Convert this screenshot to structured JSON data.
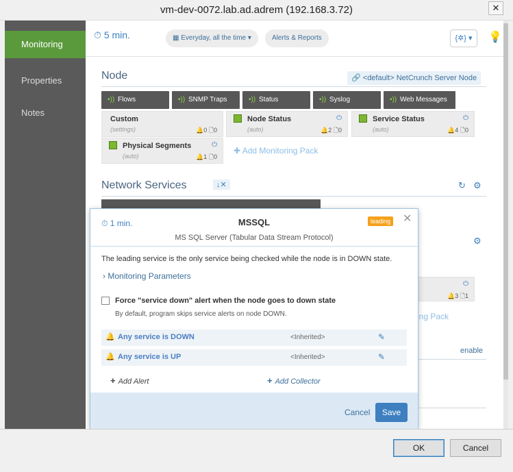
{
  "window": {
    "title": "vm-dev-0072.lab.ad.adrem (192.168.3.72)",
    "close": "✕"
  },
  "sidebar": {
    "items": [
      "Monitoring",
      "Properties",
      "Notes"
    ]
  },
  "toolbar": {
    "timer": "5 min.",
    "schedule": "Everyday, all the time",
    "alerts_reports": "Alerts & Reports",
    "settings": "{✲}"
  },
  "node": {
    "title": "Node",
    "default_tag": "<default> NetCrunch Server Node",
    "buttons": [
      "Flows",
      "SNMP Traps",
      "Status",
      "Syslog",
      "Web Messages"
    ],
    "cards": [
      {
        "name": "Custom",
        "sub": "(settings)",
        "counts": "🔔0 🗋0"
      },
      {
        "name": "Node Status",
        "sub": "(auto)",
        "counts": "🔔2 🗋0"
      },
      {
        "name": "Service Status",
        "sub": "(auto)",
        "counts": "🔔4 🗋0"
      },
      {
        "name": "Physical Segments",
        "sub": "(auto)",
        "counts": "🔔1 🗋0"
      }
    ],
    "add_pack": "Add Monitoring Pack"
  },
  "network_services": {
    "title": "Network Services",
    "partial_card_counts": "🔔3 🗋1",
    "partial_link": "ing Pack",
    "enable": "enable"
  },
  "modal": {
    "timer": "1 min.",
    "title": "MSSQL",
    "badge": "leading",
    "subtitle": "MS SQL Server (Tabular Data Stream Protocol)",
    "description": "The leading service is the only service being checked while the node is in DOWN state.",
    "params_link": "Monitoring Parameters",
    "force_label": "Force \"service down\" alert when the node goes to down state",
    "force_sub": "By default, program skips service alerts on node DOWN.",
    "alerts": [
      {
        "name": "Any service is DOWN",
        "status": "<Inherited>"
      },
      {
        "name": "Any service is UP",
        "status": "<Inherited>"
      }
    ],
    "add_alert": "Add Alert",
    "add_collector": "Add Collector",
    "cancel": "Cancel",
    "save": "Save"
  },
  "footer": {
    "ok": "OK",
    "cancel": "Cancel"
  }
}
